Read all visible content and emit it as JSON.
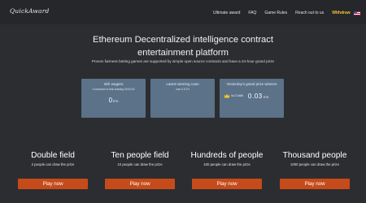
{
  "header": {
    "logo_text": "QuickAward",
    "nav": [
      {
        "label": "Ultimate award"
      },
      {
        "label": "FAQ"
      },
      {
        "label": "Game Rules"
      },
      {
        "label": "Reach out to us"
      }
    ],
    "withdraw_label": "Withdraw",
    "flag_icon": "us-flag-icon"
  },
  "hero": {
    "title": "Ethereum Decentralized intelligence contract entertainment platform",
    "subtitle": "Proven fairness betting games are supported by simple open source contracts and have a 24-hour grand prize"
  },
  "stats": {
    "card1": {
      "title": "28h wagers",
      "subtitle": "Countdown to final drawing 00:00:00",
      "value": "0",
      "unit": "ETH"
    },
    "card2": {
      "title": "Latest winning case",
      "subtitle": "user 0.8 TH"
    },
    "card3": {
      "title": "Yesterday's grand prize winners",
      "winner_name": "0x171d6f6",
      "amount": "0.03",
      "unit": "ETH"
    }
  },
  "games": [
    {
      "name": "Double field",
      "desc": "2 people can draw the prize",
      "button": "Play now"
    },
    {
      "name": "Ten people field",
      "desc": "10 people can draw the prize",
      "button": "Play now"
    },
    {
      "name": "Hundreds of people",
      "desc": "100 people can draw the prize",
      "button": "Play now"
    },
    {
      "name": "Thousand people",
      "desc": "1000 people can draw the prize",
      "button": "Play now"
    }
  ],
  "colors": {
    "background": "#2c2d31",
    "card": "#5b7288",
    "button": "#c64b1a",
    "withdraw": "#f4c430"
  }
}
